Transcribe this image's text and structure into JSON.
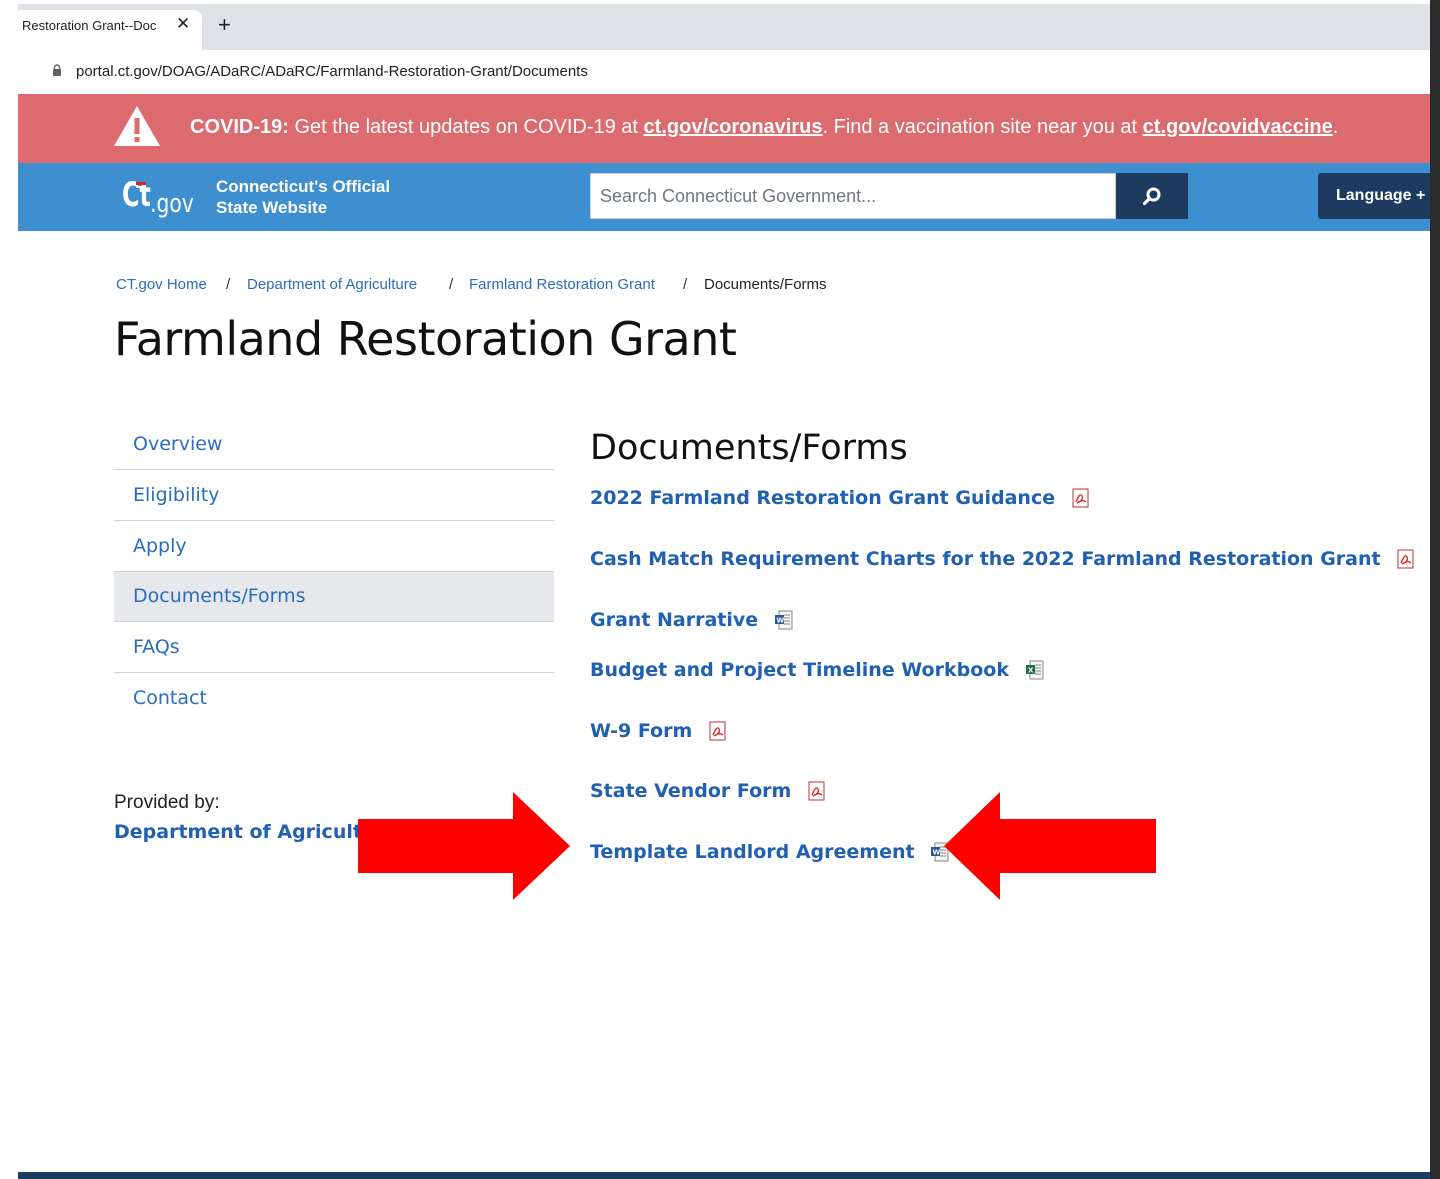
{
  "browser": {
    "tab_title": "Restoration Grant--Doc",
    "tab_close": "✕",
    "new_tab": "+",
    "url": "portal.ct.gov/DOAG/ADaRC/ADaRC/Farmland-Restoration-Grant/Documents"
  },
  "banner": {
    "label": "COVID-19:",
    "text_1": " Get the latest updates on COVID-19 at ",
    "link_1": "ct.gov/coronavirus",
    "text_2": ".  Find a vaccination site near you at ",
    "link_2": "ct.gov/covidvaccine",
    "text_3": "."
  },
  "header": {
    "logo_text": "ct.gov",
    "official_line_1": "Connecticut's Official",
    "official_line_2": "State Website",
    "search_placeholder": "Search Connecticut Government...",
    "language_label": "Language + :"
  },
  "breadcrumb": [
    "CT.gov Home",
    "Department of Agriculture",
    "Farmland Restoration Grant",
    "Documents/Forms"
  ],
  "breadcrumb_separator": "/",
  "page_title": "Farmland Restoration Grant",
  "sidebar": {
    "items": [
      "Overview",
      "Eligibility",
      "Apply",
      "Documents/Forms",
      "FAQs",
      "Contact"
    ],
    "active": "Documents/Forms",
    "provided_label": "Provided by:",
    "provided_dept": "Department of Agriculture"
  },
  "documents": {
    "heading": "Documents/Forms",
    "items": [
      {
        "title": "2022 Farmland Restoration Grant Guidance",
        "icon": "pdf-icon"
      },
      {
        "title": "Cash Match Requirement Charts for the 2022 Farmland Restoration Grant",
        "icon": "pdf-icon"
      },
      {
        "title": "Grant Narrative",
        "icon": "word-doc-icon"
      },
      {
        "title": "Budget and Project Timeline Workbook",
        "icon": "excel-icon"
      },
      {
        "title": "W-9 Form",
        "icon": "pdf-icon"
      },
      {
        "title": "State Vendor Form",
        "icon": "pdf-icon"
      },
      {
        "title": "Template Landlord Agreement",
        "icon": "word-doc-icon"
      }
    ]
  },
  "colors": {
    "banner": "#dc6b6f",
    "header": "#3d8fcf",
    "dark_button": "#1d3b5e",
    "link": "#2060b0",
    "annotation_arrow": "#ff0000"
  }
}
